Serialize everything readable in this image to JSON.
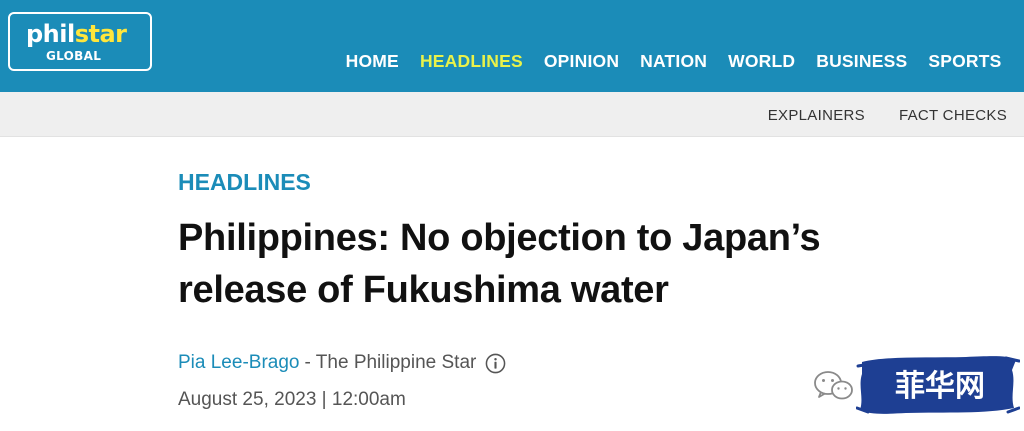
{
  "logo": {
    "main_a": "phil",
    "main_b": "star",
    "sub": "GLOBAL"
  },
  "nav": {
    "items": [
      {
        "label": "HOME",
        "active": false
      },
      {
        "label": "HEADLINES",
        "active": true
      },
      {
        "label": "OPINION",
        "active": false
      },
      {
        "label": "NATION",
        "active": false
      },
      {
        "label": "WORLD",
        "active": false
      },
      {
        "label": "BUSINESS",
        "active": false
      },
      {
        "label": "SPORTS",
        "active": false
      }
    ]
  },
  "subnav": {
    "items": [
      "EXPLAINERS",
      "FACT CHECKS"
    ]
  },
  "article": {
    "section": "HEADLINES",
    "title_line1": "Philippines: No objection to Japan’s",
    "title_line2": "release of Fukushima water",
    "author": "Pia Lee-Brago",
    "separator": "-",
    "publication": "The Philippine Star",
    "date": "August 25, 2023 | 12:00am"
  },
  "watermark": {
    "text": "菲华网"
  },
  "colors": {
    "brand_blue": "#1b8cb8",
    "nav_active": "#e9f24a",
    "logo_accent": "#ffe63b",
    "subbar_bg": "#efefef",
    "watermark_bg": "#1e3f93"
  },
  "icons": {
    "info": "info-circle-icon",
    "wechat": "wechat-icon"
  }
}
